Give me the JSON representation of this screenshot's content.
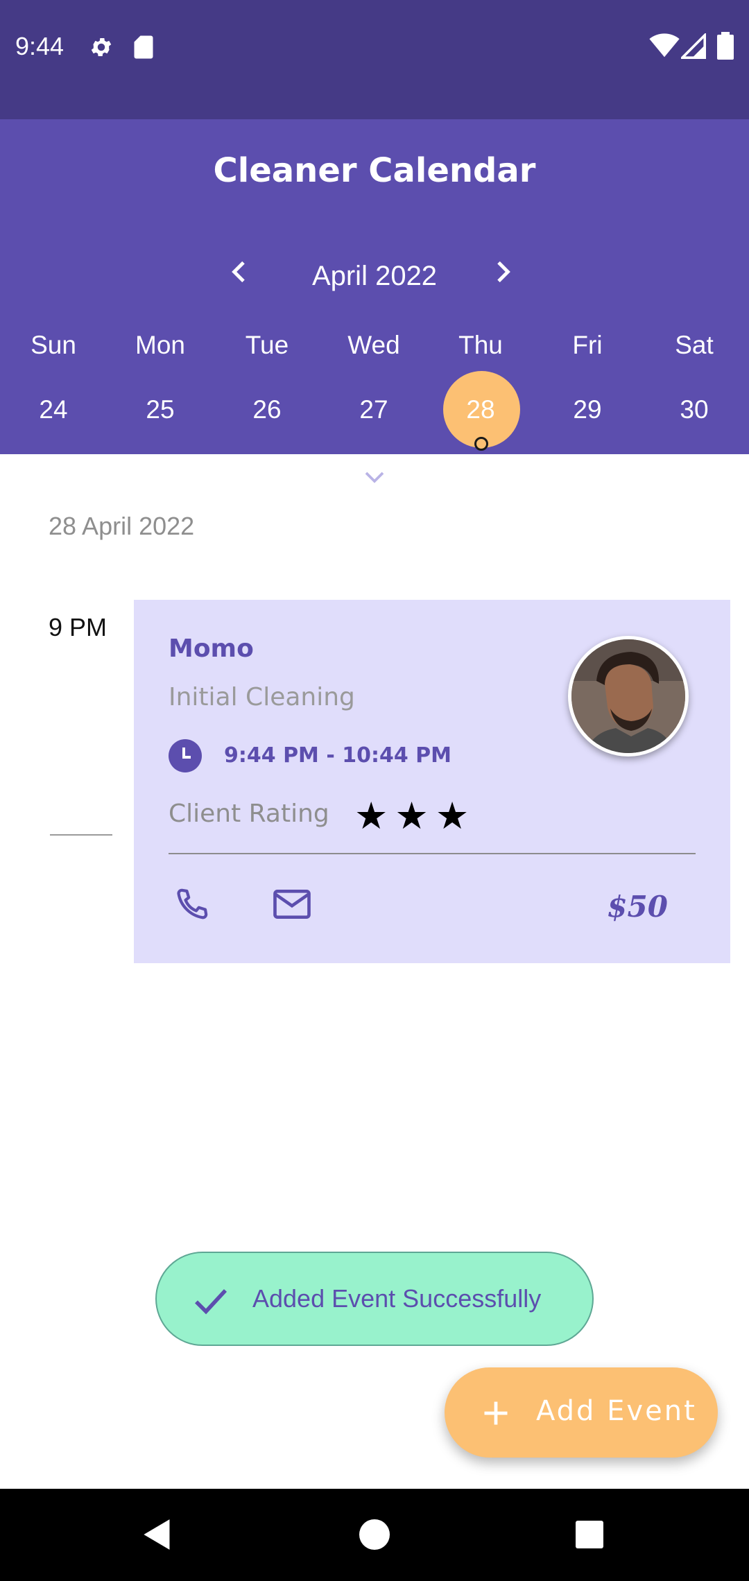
{
  "status_bar": {
    "time": "9:44"
  },
  "app": {
    "title": "Cleaner Calendar"
  },
  "calendar": {
    "month_label": "April 2022",
    "weekdays": [
      "Sun",
      "Mon",
      "Tue",
      "Wed",
      "Thu",
      "Fri",
      "Sat"
    ],
    "days": [
      "24",
      "25",
      "26",
      "27",
      "28",
      "29",
      "30"
    ],
    "selected_day": "28"
  },
  "agenda": {
    "date_heading": "28 April 2022",
    "time_label": "9 PM",
    "event": {
      "client_name": "Momo",
      "service": "Initial Cleaning",
      "time_range": "9:44 PM  -  10:44 PM",
      "rating_label": "Client Rating",
      "rating": 3,
      "stars": "★★★",
      "price": "$50"
    }
  },
  "toast": {
    "message": "Added Event Successfully"
  },
  "fab": {
    "label": "Add Event"
  },
  "colors": {
    "status_bar": "#453a86",
    "header": "#5c4eae",
    "accent": "#fcc073",
    "card": "#e0ddfb",
    "toast": "#98f2cc"
  },
  "icons": [
    "gear-icon",
    "sd-card-icon",
    "wifi-icon",
    "signal-icon",
    "battery-icon",
    "chevron-left-icon",
    "chevron-right-icon",
    "chevron-down-icon",
    "clock-icon",
    "phone-icon",
    "mail-icon",
    "check-icon",
    "plus-icon",
    "back-icon",
    "home-icon",
    "recents-icon"
  ]
}
